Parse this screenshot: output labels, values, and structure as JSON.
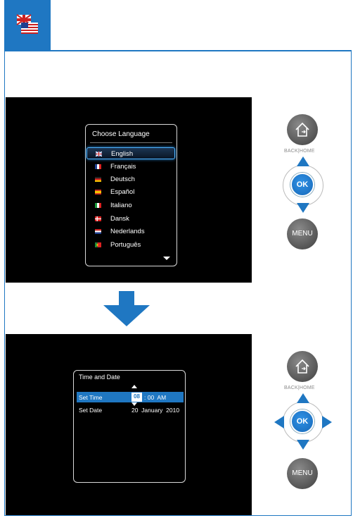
{
  "colors": {
    "accent": "#1f77c2",
    "panel_bg": "#000000",
    "button_gray": "#5a5a5a"
  },
  "header": {
    "icon": "language-flags-icon"
  },
  "language_menu": {
    "title": "Choose  Language",
    "items": [
      {
        "label": "English",
        "flag": "uk-flag-icon",
        "selected": true
      },
      {
        "label": "Français",
        "flag": "france-flag-icon"
      },
      {
        "label": "Deutsch",
        "flag": "germany-flag-icon"
      },
      {
        "label": "Español",
        "flag": "spain-flag-icon"
      },
      {
        "label": "Italiano",
        "flag": "italy-flag-icon"
      },
      {
        "label": "Dansk",
        "flag": "denmark-flag-icon"
      },
      {
        "label": "Nederlands",
        "flag": "netherlands-flag-icon"
      },
      {
        "label": "Português",
        "flag": "portugal-flag-icon"
      }
    ]
  },
  "time_date_menu": {
    "title": "Time and Date",
    "time_label": "Set Time",
    "time_hour": "08",
    "time_rest": ": 00  AM",
    "date_label": "Set Date",
    "date_value": "20  January  2010"
  },
  "controls": {
    "back_home_caption": "BACK|HOME",
    "ok_label": "OK",
    "menu_label": "MENU"
  }
}
